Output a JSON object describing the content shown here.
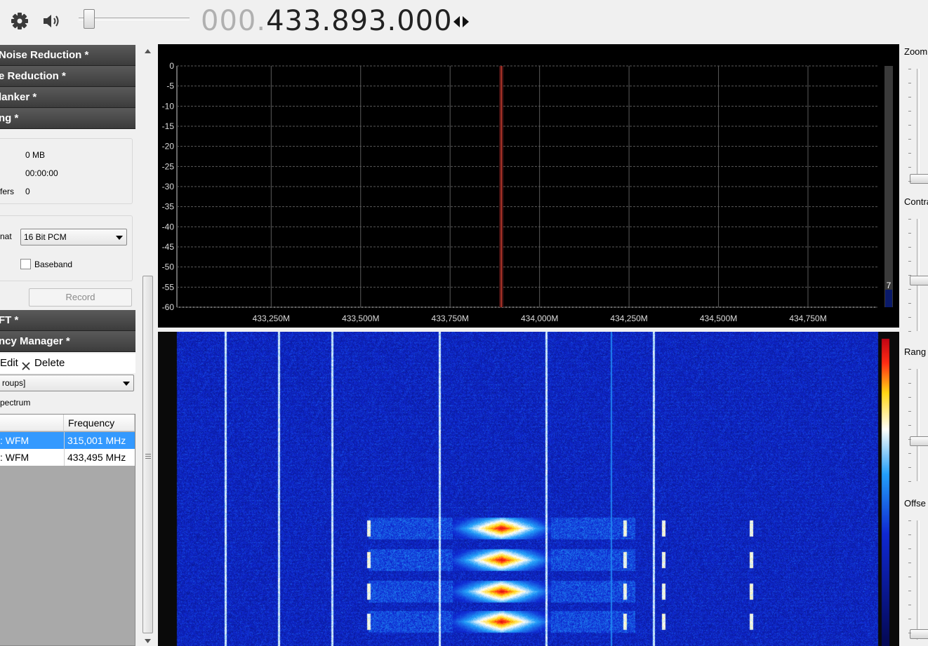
{
  "toolbar": {
    "frequency_prefix": "000.",
    "frequency_main": "433.893.000",
    "volume_level": 0.05
  },
  "left_panel": {
    "headers": [
      "Noise Reduction *",
      "e Reduction *",
      "lanker *",
      "ng *"
    ],
    "recording": {
      "size": "0 MB",
      "duration": "00:00:00",
      "buffers_label": "fers",
      "buffers_value": "0",
      "format_label": "nat",
      "format_value": "16 Bit PCM",
      "baseband_label": "Baseband",
      "baseband_checked": false,
      "record_label": "Record"
    },
    "fft_header": "FT *",
    "freq_manager_header": "ncy Manager *",
    "freq_manager": {
      "edit_label": "Edit",
      "delete_label": "Delete",
      "group_value": "roups]",
      "spectrum_label": "pectrum",
      "columns": [
        "",
        "Frequency"
      ],
      "rows": [
        {
          "name": "WFM",
          "frequency": "315,001 MHz",
          "selected": true
        },
        {
          "name": "WFM",
          "frequency": "433,495 MHz",
          "selected": false
        }
      ]
    }
  },
  "chart_data": {
    "type": "line",
    "y_ticks": [
      "0",
      "-5",
      "-10",
      "-15",
      "-20",
      "-25",
      "-30",
      "-35",
      "-40",
      "-45",
      "-50",
      "-55",
      "-60"
    ],
    "x_ticks": [
      "433,250M",
      "433,500M",
      "433,750M",
      "434,000M",
      "434,250M",
      "434,500M",
      "434,750M"
    ],
    "ylim": [
      -60,
      0
    ],
    "xlim_mhz": [
      432.9865,
      434.9442
    ],
    "tuned_frequency_mhz": 433.893,
    "grid": true,
    "level_readout": "7"
  },
  "right_panel": {
    "zoom_label": "Zoom",
    "contrast_label": "Contra",
    "range_label": "Rang",
    "offset_label": "Offse"
  },
  "colors": {
    "spectrum_bg": "#000000",
    "grid": "#5a5a5a",
    "marker": "#c0392b",
    "selection": "#3399ff",
    "header_bg": "#3c3c3c"
  }
}
